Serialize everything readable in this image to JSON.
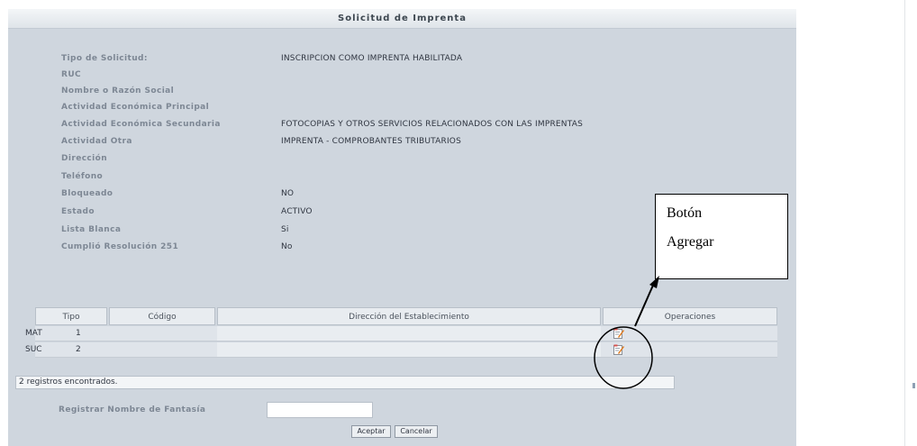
{
  "panel": {
    "title": "Solicitud de Imprenta",
    "fields": [
      {
        "label": "Tipo de Solicitud:",
        "value": "INSCRIPCION COMO IMPRENTA HABILITADA"
      },
      {
        "label": "RUC",
        "value": ""
      },
      {
        "label": "Nombre o Razón Social",
        "value": ""
      },
      {
        "label": "Actividad Económica Principal",
        "value": ""
      },
      {
        "label": "Actividad Económica Secundaria",
        "value": "FOTOCOPIAS Y OTROS SERVICIOS RELACIONADOS CON LAS IMPRENTAS"
      },
      {
        "label": "Actividad Otra",
        "value": "IMPRENTA - COMPROBANTES TRIBUTARIOS"
      },
      {
        "label": "Dirección",
        "value": ""
      },
      {
        "label": "Teléfono",
        "value": ""
      },
      {
        "label": "Bloqueado",
        "value": "NO"
      },
      {
        "label": "Estado",
        "value": "ACTIVO"
      },
      {
        "label": "Lista Blanca",
        "value": "Si"
      },
      {
        "label": "Cumplió Resolución 251",
        "value": "No"
      }
    ]
  },
  "table": {
    "headers": [
      "Tipo",
      "Código",
      "Dirección del Establecimiento",
      "Operaciones"
    ],
    "rows": [
      {
        "tipo": "MAT",
        "codigo": "1",
        "direccion": ""
      },
      {
        "tipo": "SUC",
        "codigo": "2",
        "direccion": ""
      }
    ],
    "records_text": "2 registros encontrados."
  },
  "fantasy": {
    "label": "Registrar Nombre de Fantasía",
    "input_value": ""
  },
  "buttons": {
    "accept": "Aceptar",
    "cancel": "Cancelar"
  },
  "annotation": {
    "line1": "Botón",
    "line2": "Agregar"
  },
  "icons": {
    "edit": "edit-note-icon"
  },
  "colors": {
    "panel_bg": "#cfd6de",
    "label_text": "#7d8794",
    "icon_orange": "#e07b1f"
  }
}
